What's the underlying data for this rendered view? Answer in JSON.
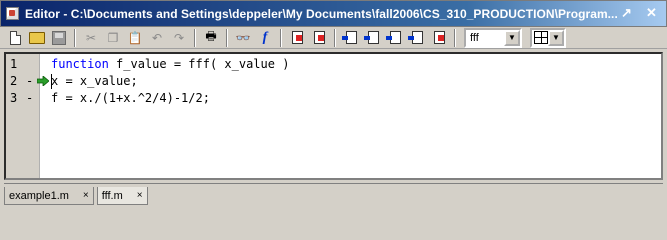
{
  "window": {
    "title": "Editor - C:\\Documents and Settings\\deppeler\\My Documents\\fall2006\\CS_310_PRODUCTION\\Program...",
    "controls": [
      "↗",
      "✕"
    ]
  },
  "toolbar": {
    "function_combo_value": "fff",
    "buttons": [
      {
        "name": "new-file-icon"
      },
      {
        "name": "open-file-icon"
      },
      {
        "name": "save-icon"
      },
      {
        "name": "cut-icon"
      },
      {
        "name": "copy-icon"
      },
      {
        "name": "paste-icon"
      },
      {
        "name": "undo-icon"
      },
      {
        "name": "redo-icon"
      },
      {
        "name": "print-icon"
      },
      {
        "name": "find-icon"
      },
      {
        "name": "function-icon"
      }
    ]
  },
  "editor": {
    "lines": [
      {
        "num": "1",
        "dash": "",
        "has_arrow": false,
        "keyword": "function",
        "text": " f_value = fff( x_value )"
      },
      {
        "num": "2",
        "dash": "-",
        "has_arrow": true,
        "keyword": "",
        "text": "x = x_value;"
      },
      {
        "num": "3",
        "dash": "-",
        "has_arrow": false,
        "keyword": "",
        "text": "f = x./(1+x.^2/4)-1/2;"
      }
    ]
  },
  "tabs": [
    {
      "label": "example1.m",
      "close": "×",
      "active": false
    },
    {
      "label": "fff.m",
      "close": "×",
      "active": true
    }
  ]
}
